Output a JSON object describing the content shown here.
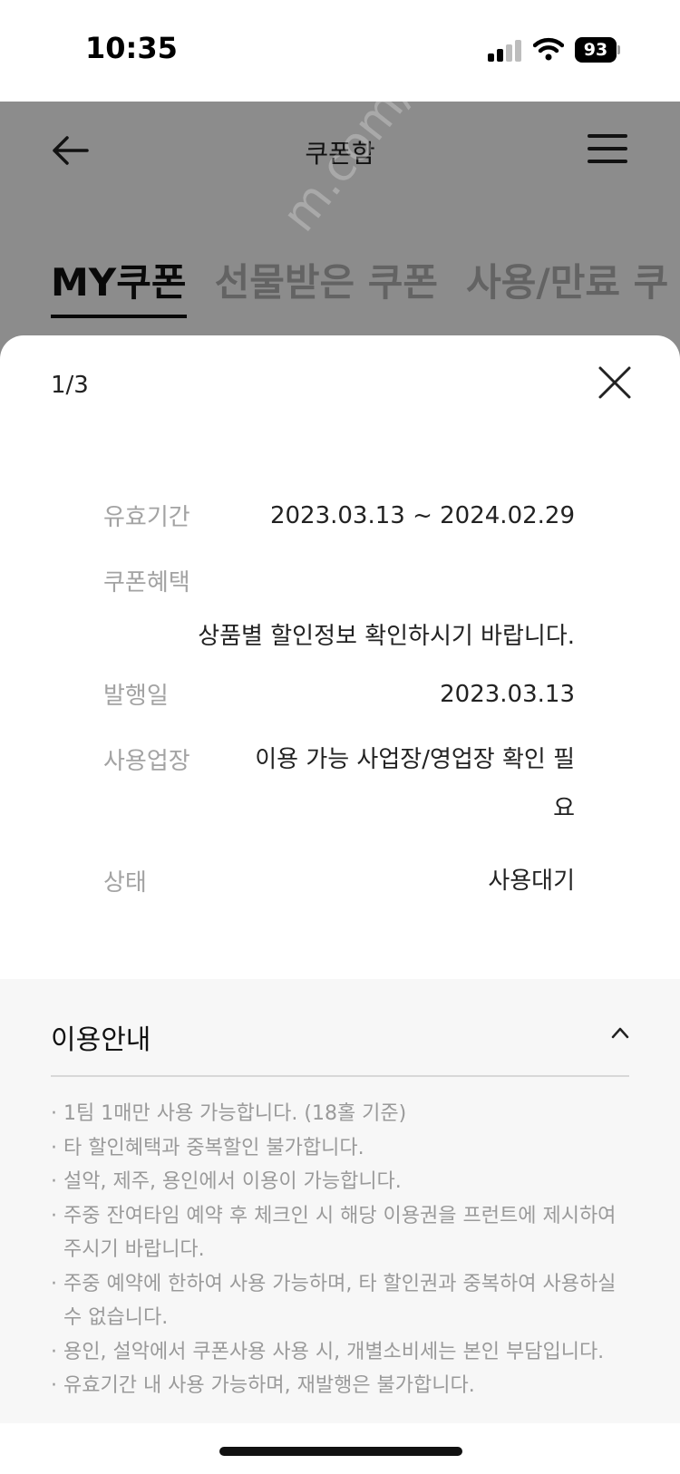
{
  "status_bar": {
    "time": "10:35",
    "battery": "93"
  },
  "header": {
    "title": "쿠폰함",
    "tabs": [
      {
        "label": "MY쿠폰",
        "active": true
      },
      {
        "label": "선물받은 쿠폰",
        "active": false
      },
      {
        "label": "사용/만료 쿠",
        "active": false
      }
    ]
  },
  "watermark": "m.com/joonggonar",
  "sheet": {
    "page_indicator": "1/3",
    "rows": [
      {
        "label": "유효기간",
        "value": "2023.03.13 ~ 2024.02.29"
      },
      {
        "label": "쿠폰혜택",
        "value": "상품별 할인정보 확인하시기 바랍니다."
      },
      {
        "label": "발행일",
        "value": "2023.03.13"
      },
      {
        "label": "사용업장",
        "value": "이용 가능 사업장/영업장 확인 필요"
      },
      {
        "label": "상태",
        "value": "사용대기"
      }
    ],
    "guide": {
      "title": "이용안내",
      "items": [
        "1팀 1매만 사용 가능합니다. (18홀 기준)",
        "타 할인혜택과 중복할인 불가합니다.",
        "설악, 제주, 용인에서 이용이 가능합니다.",
        "주중 잔여타임 예약 후 체크인 시 해당 이용권을 프런트에 제시하여 주시기 바랍니다.",
        "주중 예약에 한하여 사용 가능하며, 타 할인권과 중복하여 사용하실 수 없습니다.",
        "용인, 설악에서 쿠폰사용 사용 시, 개별소비세는 본인 부담입니다.",
        "유효기간 내 사용 가능하며, 재발행은 불가합니다."
      ]
    }
  }
}
